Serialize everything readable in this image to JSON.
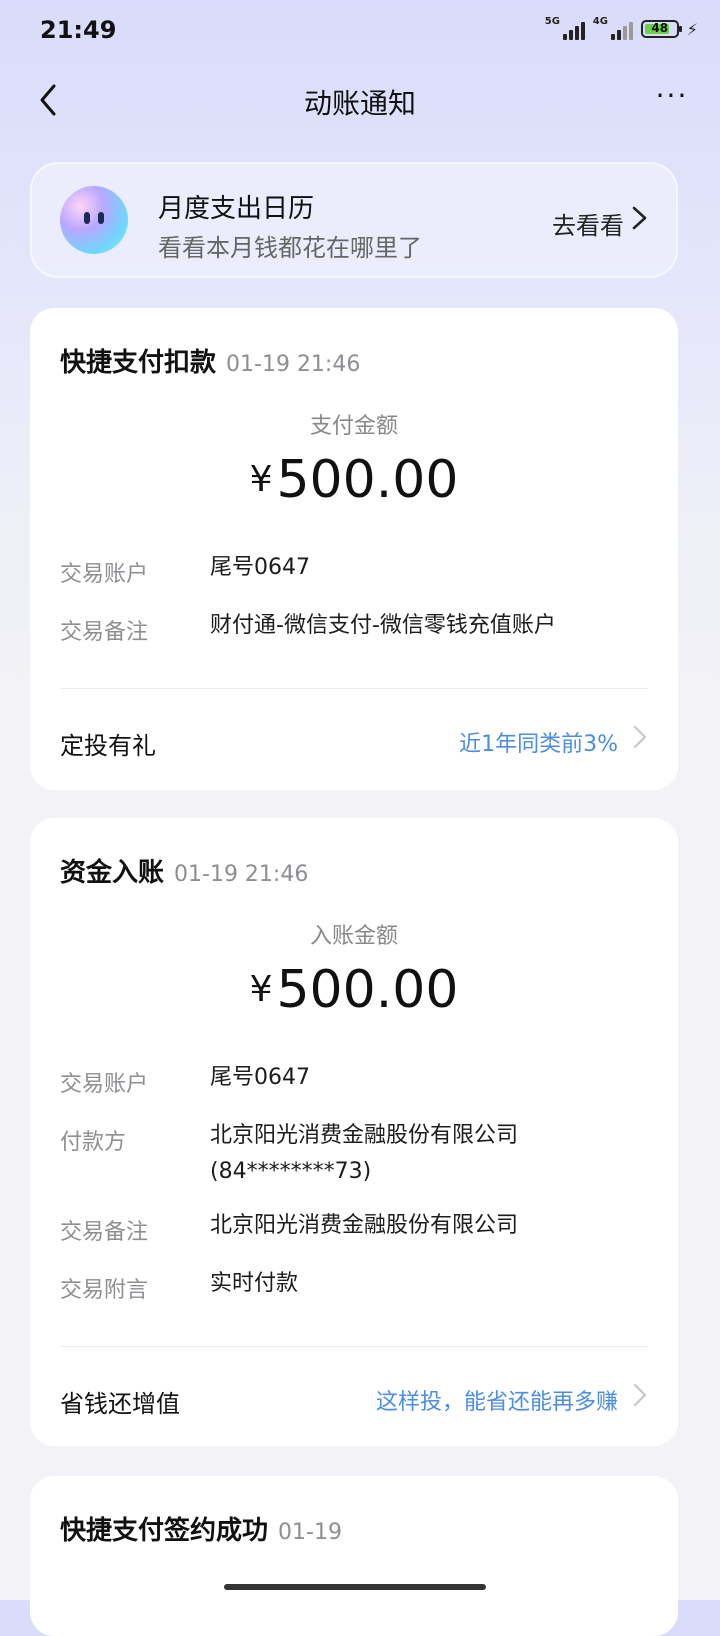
{
  "status_bar": {
    "time": "21:49",
    "signal1_label": "5G",
    "signal2_label": "4G",
    "battery": "48"
  },
  "nav": {
    "title": "动账通知",
    "more": "···"
  },
  "banner": {
    "title": "月度支出日历",
    "subtitle": "看看本月钱都花在哪里了",
    "link": "去看看"
  },
  "card1": {
    "title": "快捷支付扣款",
    "time": "01-19 21:46",
    "amount_label": "支付金额",
    "currency": "¥",
    "amount": "500.00",
    "rows": [
      {
        "key": "交易账户",
        "value": "尾号0647"
      },
      {
        "key": "交易备注",
        "value": "财付通-微信支付-微信零钱充值账户"
      }
    ],
    "promo_left": "定投有礼",
    "promo_right": "近1年同类前3%"
  },
  "card2": {
    "title": "资金入账",
    "time": "01-19 21:46",
    "amount_label": "入账金额",
    "currency": "¥",
    "amount": "500.00",
    "rows": [
      {
        "key": "交易账户",
        "value": "尾号0647"
      },
      {
        "key": "付款方",
        "value": "北京阳光消费金融股份有限公司 (84********73)"
      },
      {
        "key": "交易备注",
        "value": "北京阳光消费金融股份有限公司"
      },
      {
        "key": "交易附言",
        "value": "实时付款"
      }
    ],
    "promo_left": "省钱还增值",
    "promo_right": "这样投，能省还能再多赚"
  },
  "card3": {
    "title": "快捷支付签约成功",
    "time": "01-19"
  },
  "colors": {
    "accent_link": "#4a8de2",
    "battery_green": "#6ad04b"
  }
}
